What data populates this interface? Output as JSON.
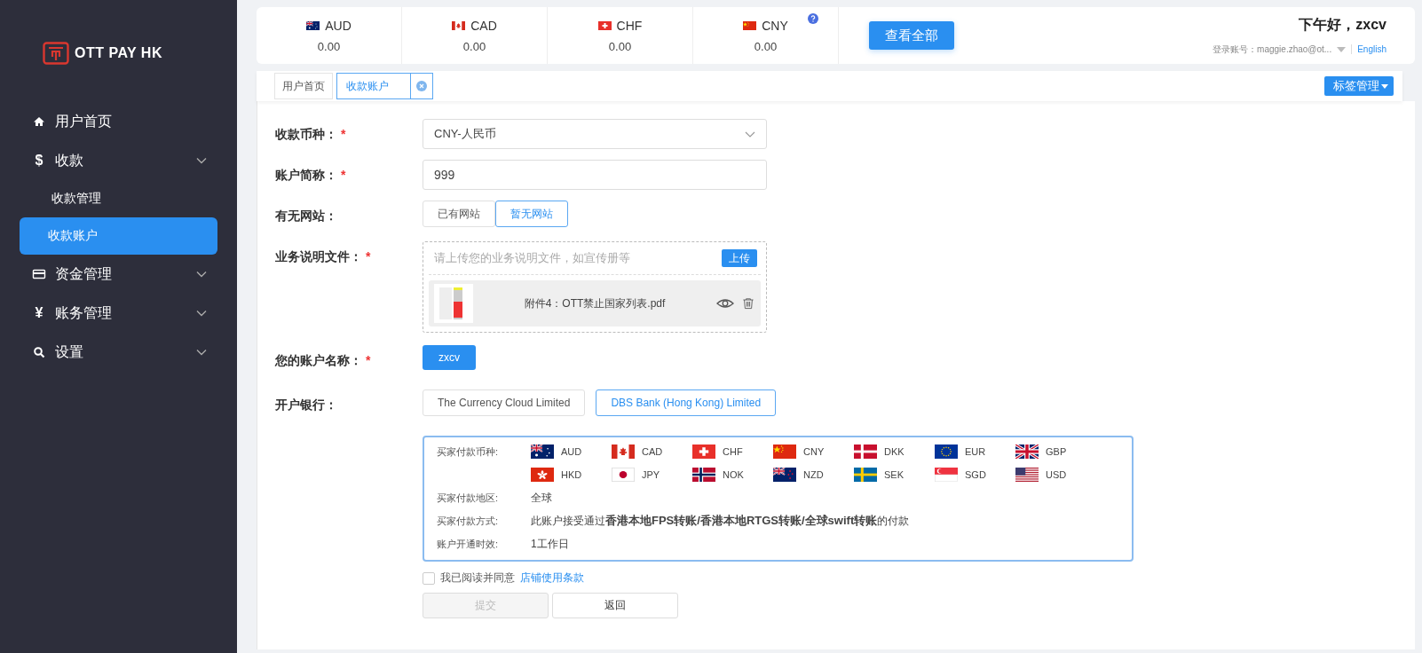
{
  "sidebar": {
    "logo": "OTT PAY HK",
    "items": [
      {
        "label": "用户首页",
        "kind": "home",
        "expandable": false,
        "selected": false
      },
      {
        "label": "收款",
        "kind": "glyph",
        "icon": "$",
        "expandable": true,
        "selected": false,
        "children": [
          {
            "label": "收款管理",
            "selected": false
          },
          {
            "label": "收款账户",
            "selected": true
          }
        ]
      },
      {
        "label": "资金管理",
        "kind": "card",
        "expandable": true,
        "selected": false
      },
      {
        "label": "账务管理",
        "kind": "glyph",
        "icon": "¥",
        "expandable": true,
        "selected": false
      },
      {
        "label": "设置",
        "kind": "search",
        "expandable": true,
        "selected": false
      }
    ]
  },
  "balances": [
    {
      "code": "AUD",
      "amount": "0.00",
      "help": false
    },
    {
      "code": "CAD",
      "amount": "0.00",
      "help": false
    },
    {
      "code": "CHF",
      "amount": "0.00",
      "help": false
    },
    {
      "code": "CNY",
      "amount": "0.00",
      "help": true
    }
  ],
  "view_all_button": "查看全部",
  "user": {
    "greeting": "下午好，zxcv",
    "account": "登录账号：maggie.zhao@ot...",
    "language": "English"
  },
  "tabs": [
    {
      "label": "用户首页",
      "selected": false,
      "closable": false
    },
    {
      "label": "收款账户",
      "selected": true,
      "closable": true
    }
  ],
  "tag_menu_button": "标签管理",
  "form": {
    "rows": [
      {
        "label": "收款币种：",
        "required_mark": "*",
        "kind": "select",
        "value": "CNY-人民币"
      },
      {
        "label": "账户简称：",
        "required_mark": "*",
        "kind": "input",
        "value": "999"
      },
      {
        "label": "有无网站：",
        "kind": "options",
        "options": [
          {
            "label": "已有网站",
            "selected": false
          },
          {
            "label": "暂无网站",
            "selected": true
          }
        ]
      },
      {
        "label": "业务说明文件：",
        "required_mark": "*",
        "kind": "upload",
        "placeholder": "请上传您的业务说明文件，如宣传册等",
        "button": "上传",
        "file": "附件4：OTT禁止国家列表.pdf"
      },
      {
        "label": "您的账户名称：",
        "required_mark": "*",
        "kind": "tag",
        "value": "zxcv"
      },
      {
        "label": "开户银行：",
        "kind": "options",
        "options": [
          {
            "label": "The Currency Cloud Limited",
            "selected": false
          },
          {
            "label": "DBS Bank (Hong Kong) Limited",
            "selected": true
          }
        ]
      }
    ]
  },
  "bank_info": {
    "currency_label": "买家付款币种:",
    "currencies": [
      "AUD",
      "CAD",
      "CHF",
      "CNY",
      "DKK",
      "EUR",
      "GBP",
      "HKD",
      "JPY",
      "NOK",
      "NZD",
      "SEK",
      "SGD",
      "USD"
    ],
    "rows": [
      {
        "label": "买家付款地区:",
        "value": "全球"
      },
      {
        "label": "买家付款方式:",
        "value": "此账户接受通过**香港本地FPS转账/香港本地RTGS转账/全球swift转账**的付款"
      },
      {
        "label": "账户开通时效:",
        "value": "1工作日"
      }
    ]
  },
  "agreement": {
    "checked": false,
    "text": "我已阅读并同意",
    "link": "店铺使用条款"
  },
  "buttons": [
    {
      "label": "提交",
      "disabled": true
    },
    {
      "label": "返回",
      "disabled": false
    }
  ]
}
